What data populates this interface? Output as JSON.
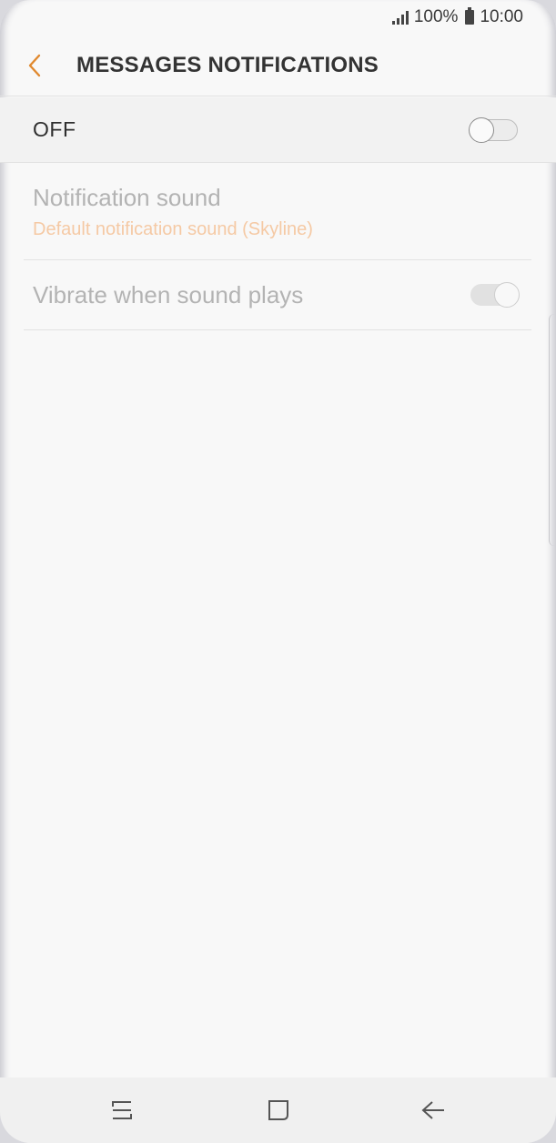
{
  "status_bar": {
    "battery_percent": "100%",
    "time": "10:00",
    "signal_icon": "signal-icon",
    "battery_icon": "battery-icon"
  },
  "app_bar": {
    "back_icon": "chevron-left-icon",
    "title": "MESSAGES NOTIFICATIONS"
  },
  "master_switch": {
    "label": "OFF",
    "state": "off"
  },
  "settings": {
    "notification_sound": {
      "title": "Notification sound",
      "value": "Default notification sound (Skyline)"
    },
    "vibrate": {
      "title": "Vibrate when sound plays",
      "state": "on (disabled)"
    }
  },
  "nav_bar": {
    "recents_icon": "recent-apps-icon",
    "home_icon": "home-icon",
    "back_icon": "back-arrow-icon"
  },
  "colors": {
    "accent": "#e0892f",
    "subtitle_disabled": "#f5c9a4",
    "background": "#f8f8f8"
  }
}
